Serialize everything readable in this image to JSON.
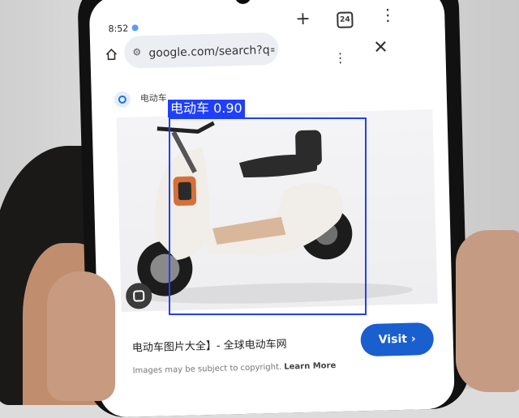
{
  "status": {
    "time": "8:52"
  },
  "tabs": {
    "count": "24"
  },
  "address_bar": {
    "url": "google.com/search?q=目"
  },
  "panel": {
    "source_label": "电动车"
  },
  "result": {
    "title": "电动车图片大全】- 全球电动车网",
    "visit_label": "Visit ›",
    "copyright": "Images may be subject to copyright.",
    "learn_more": "Learn More"
  },
  "detection": {
    "label": "电动车 0.90",
    "class": "电动车",
    "confidence": 0.9
  },
  "colors": {
    "accent": "#1a5fce",
    "box": "#1f3fff",
    "scooter_body": "#f1ede8",
    "scooter_trim": "#d4703a"
  },
  "icons": [
    "home-icon",
    "tune-icon",
    "plus-icon",
    "tabs-icon",
    "more-vert-icon",
    "close-icon",
    "lens-icon",
    "lens-search-icon"
  ]
}
